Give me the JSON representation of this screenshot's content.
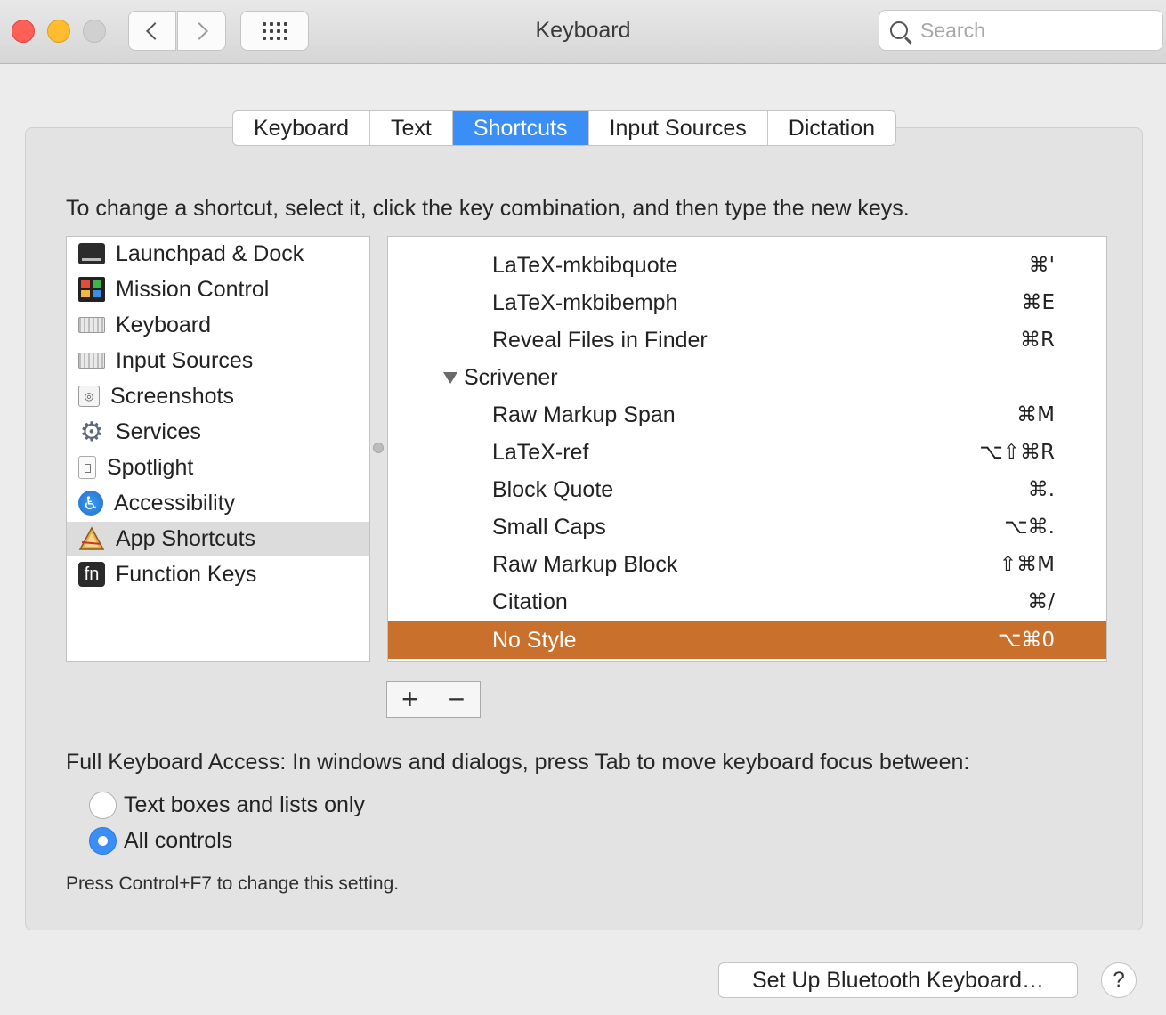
{
  "window": {
    "title": "Keyboard"
  },
  "search": {
    "placeholder": "Search"
  },
  "tabs": [
    {
      "label": "Keyboard"
    },
    {
      "label": "Text"
    },
    {
      "label": "Shortcuts",
      "active": true
    },
    {
      "label": "Input Sources"
    },
    {
      "label": "Dictation"
    }
  ],
  "instructions": "To change a shortcut, select it, click the key combination, and then type the new keys.",
  "categories": [
    {
      "label": "Launchpad & Dock",
      "icon": "launchpad-icon"
    },
    {
      "label": "Mission Control",
      "icon": "mission-control-icon"
    },
    {
      "label": "Keyboard",
      "icon": "keyboard-icon"
    },
    {
      "label": "Input Sources",
      "icon": "input-sources-icon"
    },
    {
      "label": "Screenshots",
      "icon": "screenshot-icon"
    },
    {
      "label": "Services",
      "icon": "gear-icon"
    },
    {
      "label": "Spotlight",
      "icon": "spotlight-icon"
    },
    {
      "label": "Accessibility",
      "icon": "accessibility-icon"
    },
    {
      "label": "App Shortcuts",
      "icon": "app-shortcuts-icon",
      "selected": true
    },
    {
      "label": "Function Keys",
      "icon": "fn-key-icon"
    }
  ],
  "shortcuts": [
    {
      "name": "LaTeX-mkbibquote",
      "key": "⌘'"
    },
    {
      "name": "LaTeX-mkbibemph",
      "key": "⌘E"
    },
    {
      "name": "Reveal Files in Finder",
      "key": "⌘R"
    },
    {
      "name": "Scrivener",
      "group": true
    },
    {
      "name": "Raw Markup Span",
      "key": "⌘M"
    },
    {
      "name": "LaTeX-ref",
      "key": "⌥⇧⌘R"
    },
    {
      "name": "Block Quote",
      "key": "⌘."
    },
    {
      "name": "Small Caps",
      "key": "⌥⌘."
    },
    {
      "name": "Raw Markup Block",
      "key": "⇧⌘M"
    },
    {
      "name": "Citation",
      "key": "⌘/"
    },
    {
      "name": "No Style",
      "key": "⌥⌘0",
      "selected": true
    }
  ],
  "list_buttons": {
    "add": "+",
    "remove": "−"
  },
  "full_keyboard_access": {
    "label": "Full Keyboard Access: In windows and dialogs, press Tab to move keyboard focus between:",
    "options": [
      {
        "label": "Text boxes and lists only",
        "checked": false
      },
      {
        "label": "All controls",
        "checked": true
      }
    ],
    "hint": "Press Control+F7 to change this setting."
  },
  "bluetooth_button": "Set Up Bluetooth Keyboard…",
  "help_button": "?"
}
